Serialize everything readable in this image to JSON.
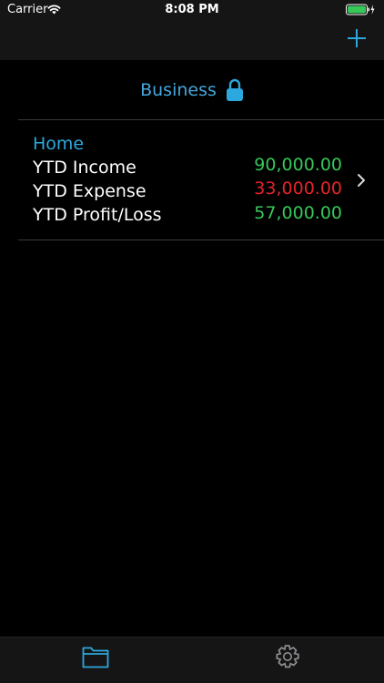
{
  "status_bar": {
    "carrier": "Carrier",
    "time": "8:08 PM",
    "wifi_icon": "wifi-icon",
    "battery_icon": "battery-charging-icon"
  },
  "nav_bar": {
    "add_icon": "plus-icon"
  },
  "section": {
    "title": "Business",
    "lock_icon": "lock-icon"
  },
  "account": {
    "name": "Home",
    "rows": [
      {
        "label": "YTD Income",
        "value": "90,000.00",
        "color": "#36c759"
      },
      {
        "label": "YTD Expense",
        "value": "33,000.00",
        "color": "#e5232b"
      },
      {
        "label": "YTD Profit/Loss",
        "value": "57,000.00",
        "color": "#36c759"
      }
    ],
    "chevron_icon": "chevron-right-icon"
  },
  "tab_bar": {
    "tabs": [
      {
        "name": "accounts",
        "icon": "folder-icon",
        "active": true
      },
      {
        "name": "settings",
        "icon": "gear-icon",
        "active": false
      }
    ]
  },
  "colors": {
    "accent": "#2da8de",
    "positive": "#36c759",
    "negative": "#e5232b",
    "bar_background": "#151515",
    "background": "#000000"
  }
}
